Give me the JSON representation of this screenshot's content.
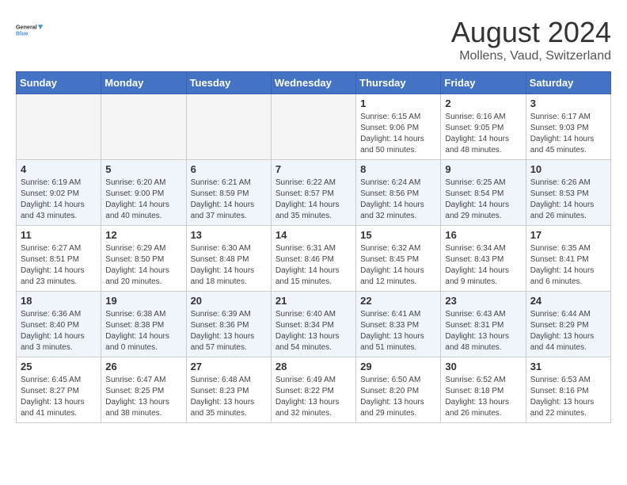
{
  "header": {
    "logo_line1": "General",
    "logo_line2": "Blue",
    "main_title": "August 2024",
    "subtitle": "Mollens, Vaud, Switzerland"
  },
  "days_of_week": [
    "Sunday",
    "Monday",
    "Tuesday",
    "Wednesday",
    "Thursday",
    "Friday",
    "Saturday"
  ],
  "weeks": [
    [
      {
        "num": "",
        "info": ""
      },
      {
        "num": "",
        "info": ""
      },
      {
        "num": "",
        "info": ""
      },
      {
        "num": "",
        "info": ""
      },
      {
        "num": "1",
        "info": "Sunrise: 6:15 AM\nSunset: 9:06 PM\nDaylight: 14 hours and 50 minutes."
      },
      {
        "num": "2",
        "info": "Sunrise: 6:16 AM\nSunset: 9:05 PM\nDaylight: 14 hours and 48 minutes."
      },
      {
        "num": "3",
        "info": "Sunrise: 6:17 AM\nSunset: 9:03 PM\nDaylight: 14 hours and 45 minutes."
      }
    ],
    [
      {
        "num": "4",
        "info": "Sunrise: 6:19 AM\nSunset: 9:02 PM\nDaylight: 14 hours and 43 minutes."
      },
      {
        "num": "5",
        "info": "Sunrise: 6:20 AM\nSunset: 9:00 PM\nDaylight: 14 hours and 40 minutes."
      },
      {
        "num": "6",
        "info": "Sunrise: 6:21 AM\nSunset: 8:59 PM\nDaylight: 14 hours and 37 minutes."
      },
      {
        "num": "7",
        "info": "Sunrise: 6:22 AM\nSunset: 8:57 PM\nDaylight: 14 hours and 35 minutes."
      },
      {
        "num": "8",
        "info": "Sunrise: 6:24 AM\nSunset: 8:56 PM\nDaylight: 14 hours and 32 minutes."
      },
      {
        "num": "9",
        "info": "Sunrise: 6:25 AM\nSunset: 8:54 PM\nDaylight: 14 hours and 29 minutes."
      },
      {
        "num": "10",
        "info": "Sunrise: 6:26 AM\nSunset: 8:53 PM\nDaylight: 14 hours and 26 minutes."
      }
    ],
    [
      {
        "num": "11",
        "info": "Sunrise: 6:27 AM\nSunset: 8:51 PM\nDaylight: 14 hours and 23 minutes."
      },
      {
        "num": "12",
        "info": "Sunrise: 6:29 AM\nSunset: 8:50 PM\nDaylight: 14 hours and 20 minutes."
      },
      {
        "num": "13",
        "info": "Sunrise: 6:30 AM\nSunset: 8:48 PM\nDaylight: 14 hours and 18 minutes."
      },
      {
        "num": "14",
        "info": "Sunrise: 6:31 AM\nSunset: 8:46 PM\nDaylight: 14 hours and 15 minutes."
      },
      {
        "num": "15",
        "info": "Sunrise: 6:32 AM\nSunset: 8:45 PM\nDaylight: 14 hours and 12 minutes."
      },
      {
        "num": "16",
        "info": "Sunrise: 6:34 AM\nSunset: 8:43 PM\nDaylight: 14 hours and 9 minutes."
      },
      {
        "num": "17",
        "info": "Sunrise: 6:35 AM\nSunset: 8:41 PM\nDaylight: 14 hours and 6 minutes."
      }
    ],
    [
      {
        "num": "18",
        "info": "Sunrise: 6:36 AM\nSunset: 8:40 PM\nDaylight: 14 hours and 3 minutes."
      },
      {
        "num": "19",
        "info": "Sunrise: 6:38 AM\nSunset: 8:38 PM\nDaylight: 14 hours and 0 minutes."
      },
      {
        "num": "20",
        "info": "Sunrise: 6:39 AM\nSunset: 8:36 PM\nDaylight: 13 hours and 57 minutes."
      },
      {
        "num": "21",
        "info": "Sunrise: 6:40 AM\nSunset: 8:34 PM\nDaylight: 13 hours and 54 minutes."
      },
      {
        "num": "22",
        "info": "Sunrise: 6:41 AM\nSunset: 8:33 PM\nDaylight: 13 hours and 51 minutes."
      },
      {
        "num": "23",
        "info": "Sunrise: 6:43 AM\nSunset: 8:31 PM\nDaylight: 13 hours and 48 minutes."
      },
      {
        "num": "24",
        "info": "Sunrise: 6:44 AM\nSunset: 8:29 PM\nDaylight: 13 hours and 44 minutes."
      }
    ],
    [
      {
        "num": "25",
        "info": "Sunrise: 6:45 AM\nSunset: 8:27 PM\nDaylight: 13 hours and 41 minutes."
      },
      {
        "num": "26",
        "info": "Sunrise: 6:47 AM\nSunset: 8:25 PM\nDaylight: 13 hours and 38 minutes."
      },
      {
        "num": "27",
        "info": "Sunrise: 6:48 AM\nSunset: 8:23 PM\nDaylight: 13 hours and 35 minutes."
      },
      {
        "num": "28",
        "info": "Sunrise: 6:49 AM\nSunset: 8:22 PM\nDaylight: 13 hours and 32 minutes."
      },
      {
        "num": "29",
        "info": "Sunrise: 6:50 AM\nSunset: 8:20 PM\nDaylight: 13 hours and 29 minutes."
      },
      {
        "num": "30",
        "info": "Sunrise: 6:52 AM\nSunset: 8:18 PM\nDaylight: 13 hours and 26 minutes."
      },
      {
        "num": "31",
        "info": "Sunrise: 6:53 AM\nSunset: 8:16 PM\nDaylight: 13 hours and 22 minutes."
      }
    ]
  ]
}
